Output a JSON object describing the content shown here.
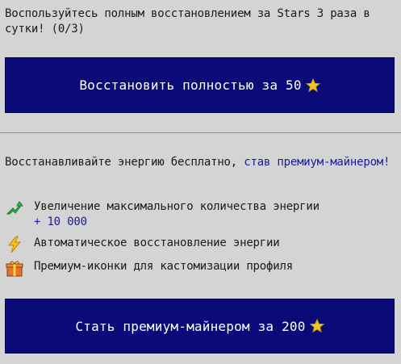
{
  "restore": {
    "info_text": "Воспользуйтесь полным восстановлением за Stars 3 раза в сутки! (0/3)",
    "button_label": "Восстановить полностью за 50"
  },
  "premium": {
    "intro_text": "Восстанавливайте энергию бесплатно, ",
    "intro_link": "став премиум-майнером!",
    "features": [
      {
        "icon": "upgrade-arrow-icon",
        "text": "Увеличение максимального количества энергии",
        "bonus": "+ 10 000"
      },
      {
        "icon": "lightning-icon",
        "text": "Автоматическое восстановление энергии"
      },
      {
        "icon": "gift-icon",
        "text": "Премиум-иконки для кастомизации профиля"
      }
    ],
    "button_label": "Стать премиум-майнером за 200"
  },
  "colors": {
    "background": "#d4d4d4",
    "button": "#0a0a78",
    "link": "#1a1a9e",
    "star": "#f2c61f"
  },
  "icons": {
    "currency": "star-icon"
  }
}
